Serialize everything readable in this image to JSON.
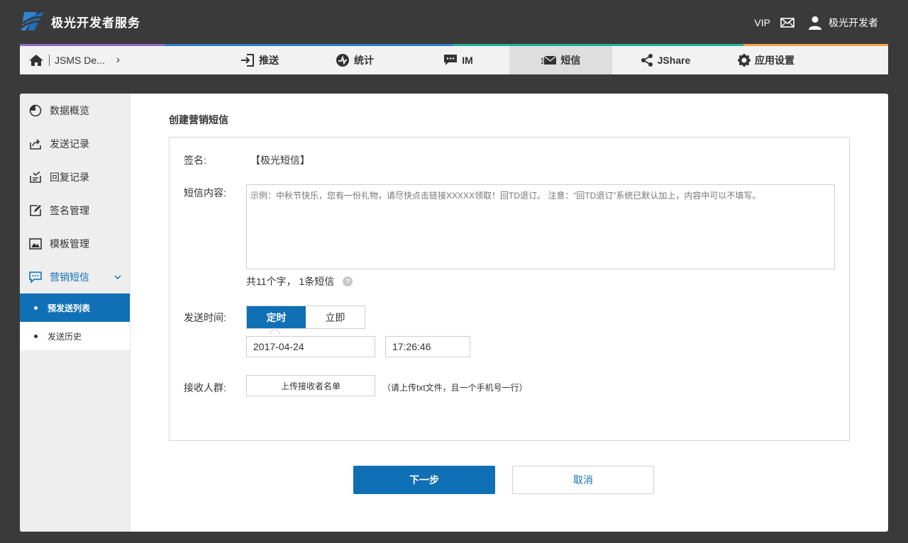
{
  "brand": {
    "name": "极光开发者服务"
  },
  "header": {
    "vip": "VIP",
    "user_name": "极光开发者"
  },
  "nav": {
    "stripe_colors": [
      "#8f6fc0",
      "#2f7fd1",
      "#2f7fd1",
      "#1fb59b",
      "#1fb59b",
      "#f3a54b"
    ],
    "breadcrumb": "JSMS De...",
    "tabs": [
      {
        "label": "推送",
        "icon": "push-icon"
      },
      {
        "label": "统计",
        "icon": "stats-icon"
      },
      {
        "label": "IM",
        "icon": "chat-icon"
      },
      {
        "label": "短信",
        "icon": "sms-icon",
        "active": true
      },
      {
        "label": "JShare",
        "icon": "share-icon"
      },
      {
        "label": "应用设置",
        "icon": "gear-icon"
      }
    ]
  },
  "sidebar": {
    "items": [
      {
        "label": "数据概览",
        "icon": "pie-chart-icon"
      },
      {
        "label": "发送记录",
        "icon": "send-record-icon"
      },
      {
        "label": "回复记录",
        "icon": "reply-record-icon"
      },
      {
        "label": "签名管理",
        "icon": "signature-icon"
      },
      {
        "label": "模板管理",
        "icon": "template-icon"
      },
      {
        "label": "营销短信",
        "icon": "marketing-sms-icon",
        "active": true
      }
    ],
    "sub_items": [
      {
        "label": "预发送列表",
        "active": true
      },
      {
        "label": "发送历史"
      }
    ]
  },
  "form": {
    "title": "创建营销短信",
    "sign_label": "签名:",
    "sign_value": "【极光短信】",
    "content_label": "短信内容:",
    "content_placeholder": "示例：中秋节快乐，您有一份礼物，请尽快点击链接XXXXX领取！回TD退订。 注意：“回TD退订”系统已默认加上，内容中可以不填写。",
    "counter_text": "共11个字， 1条短信",
    "help_mark": "?",
    "time_label": "发送时间:",
    "time_options": [
      "定时",
      "立即"
    ],
    "date_value": "2017-04-24",
    "time_value": "17:26:46",
    "receivers_label": "接收人群:",
    "upload_label": "上传接收者名单",
    "upload_hint": "（请上传txt文件，且一个手机号一行）"
  },
  "actions": {
    "next": "下一步",
    "cancel": "取消"
  },
  "colors": {
    "primary": "#0f70b5",
    "background": "#3a3a3a"
  }
}
